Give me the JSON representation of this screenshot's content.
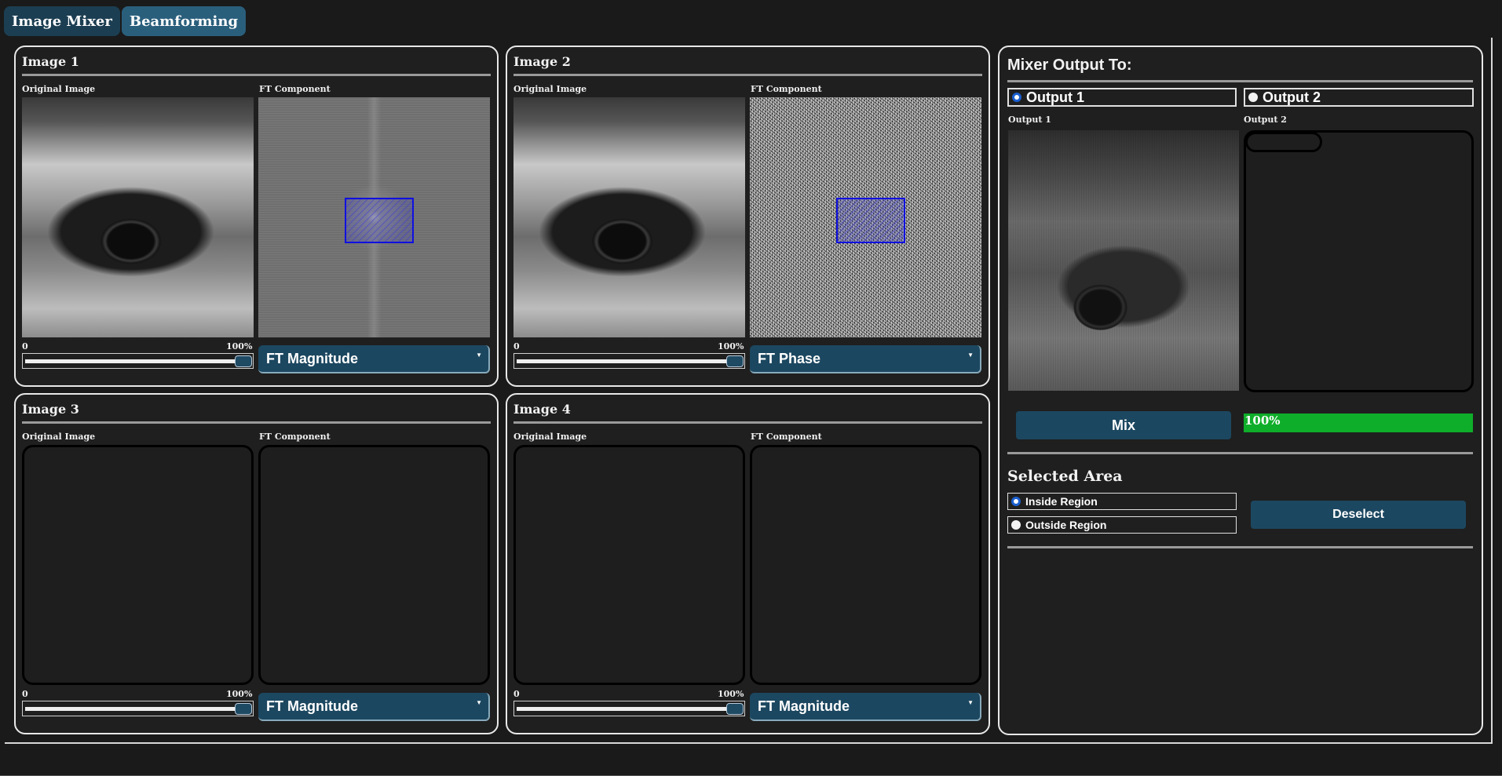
{
  "tabs": [
    {
      "label": "Image Mixer",
      "active": false
    },
    {
      "label": "Beamforming",
      "active": true
    }
  ],
  "panels": [
    {
      "title": "Image 1",
      "original_label": "Original Image",
      "ft_label": "FT Component",
      "scale_min": "0",
      "scale_max": "100%",
      "weight": 1.0,
      "component": "FT Magnitude",
      "has_image": true,
      "ft_style": "magnitude",
      "has_selection": true
    },
    {
      "title": "Image 2",
      "original_label": "Original Image",
      "ft_label": "FT Component",
      "scale_min": "0",
      "scale_max": "100%",
      "weight": 1.0,
      "component": "FT Phase",
      "has_image": true,
      "ft_style": "phase",
      "has_selection": true
    },
    {
      "title": "Image 3",
      "original_label": "Original Image",
      "ft_label": "FT Component",
      "scale_min": "0",
      "scale_max": "100%",
      "weight": 1.0,
      "component": "FT Magnitude",
      "has_image": false
    },
    {
      "title": "Image 4",
      "original_label": "Original Image",
      "ft_label": "FT Component",
      "scale_min": "0",
      "scale_max": "100%",
      "weight": 1.0,
      "component": "FT Magnitude",
      "has_image": false
    }
  ],
  "mixer": {
    "title": "Mixer Output To:",
    "outputs": [
      {
        "label": "Output 1",
        "checked": true
      },
      {
        "label": "Output 2",
        "checked": false
      }
    ],
    "output1_label": "Output 1",
    "output2_label": "Output 2",
    "mix_label": "Mix",
    "progress_text": "100%",
    "progress_value": 1.0,
    "progress_color": "#0fae2a",
    "selected_area_title": "Selected Area",
    "regions": [
      {
        "label": "Inside Region",
        "checked": true
      },
      {
        "label": "Outside Region",
        "checked": false
      }
    ],
    "deselect_label": "Deselect"
  },
  "colors": {
    "accent": "#1c4760",
    "selection": "#1010e0"
  }
}
